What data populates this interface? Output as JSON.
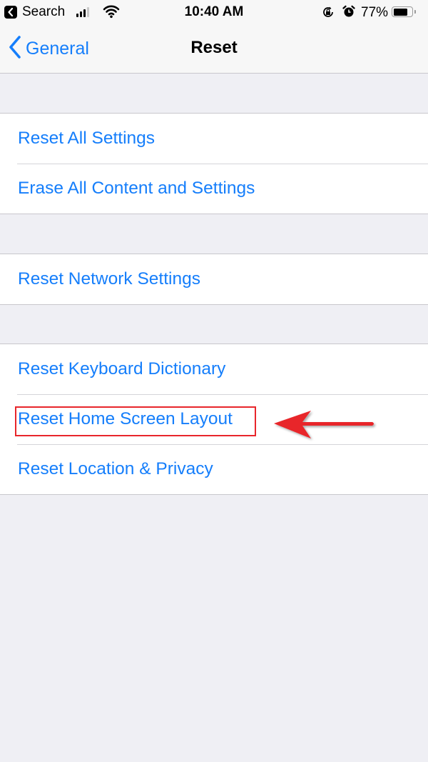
{
  "status_bar": {
    "back_app_label": "Search",
    "time": "10:40 AM",
    "battery_percent_label": "77%",
    "battery_level": 0.77,
    "signal_bars_active": 3,
    "signal_bars_total": 4,
    "icons": [
      "back-to-app-icon",
      "cellular-signal-icon",
      "wifi-icon",
      "orientation-lock-icon",
      "alarm-icon",
      "battery-icon"
    ]
  },
  "nav": {
    "back_label": "General",
    "title": "Reset"
  },
  "groups": [
    {
      "items": [
        {
          "label": "Reset All Settings"
        },
        {
          "label": "Erase All Content and Settings"
        }
      ]
    },
    {
      "items": [
        {
          "label": "Reset Network Settings"
        }
      ]
    },
    {
      "items": [
        {
          "label": "Reset Keyboard Dictionary"
        },
        {
          "label": "Reset Home Screen Layout"
        },
        {
          "label": "Reset Location & Privacy"
        }
      ]
    }
  ],
  "annotation": {
    "highlighted_item": "Reset Home Screen Layout",
    "highlight_color": "#e8262b",
    "arrow_direction": "left"
  },
  "colors": {
    "accent": "#157efb",
    "background": "#efeff4",
    "annotation": "#e8262b"
  }
}
